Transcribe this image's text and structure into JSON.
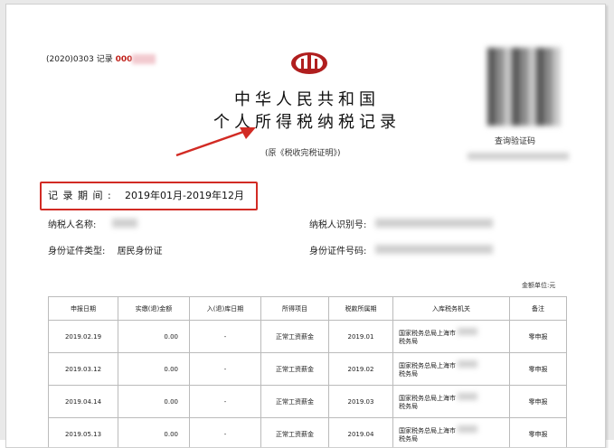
{
  "header": {
    "record_number_prefix": "(2020)0303",
    "record_label": "记录",
    "record_number": "000",
    "title_line1": "中华人民共和国",
    "title_line2": "个人所得税纳税记录",
    "subtitle": "(原《税收完税证明》)",
    "qr_label": "查询验证码"
  },
  "period": {
    "label": "记 录 期 间 :",
    "value": "2019年01月-2019年12月"
  },
  "taxpayer": {
    "name_label": "纳税人名称:",
    "id_label": "纳税人识别号:",
    "doc_type_label": "身份证件类型:",
    "doc_type_value": "居民身份证",
    "doc_number_label": "身份证件号码:"
  },
  "table": {
    "unit_label": "金额单位:元",
    "headers": [
      "申报日期",
      "实缴(退)金额",
      "入(退)库日期",
      "所得项目",
      "税款所属期",
      "入库税务机关",
      "备注"
    ],
    "rows": [
      {
        "date": "2019.02.19",
        "amount": "0.00",
        "storage_date": "-",
        "item": "正常工资薪金",
        "period": "2019.01",
        "org_line1": "国家税务总局上海市",
        "org_line2": "税务局",
        "note": "零申报"
      },
      {
        "date": "2019.03.12",
        "amount": "0.00",
        "storage_date": "-",
        "item": "正常工资薪金",
        "period": "2019.02",
        "org_line1": "国家税务总局上海市",
        "org_line2": "税务局",
        "note": "零申报"
      },
      {
        "date": "2019.04.14",
        "amount": "0.00",
        "storage_date": "-",
        "item": "正常工资薪金",
        "period": "2019.03",
        "org_line1": "国家税务总局上海市",
        "org_line2": "税务局",
        "note": "零申报"
      },
      {
        "date": "2019.05.13",
        "amount": "0.00",
        "storage_date": "-",
        "item": "正常工资薪金",
        "period": "2019.04",
        "org_line1": "国家税务总局上海市",
        "org_line2": "税务局",
        "note": "零申报"
      }
    ]
  },
  "colors": {
    "highlight_red": "#d22b24",
    "record_red": "#c0221b"
  }
}
